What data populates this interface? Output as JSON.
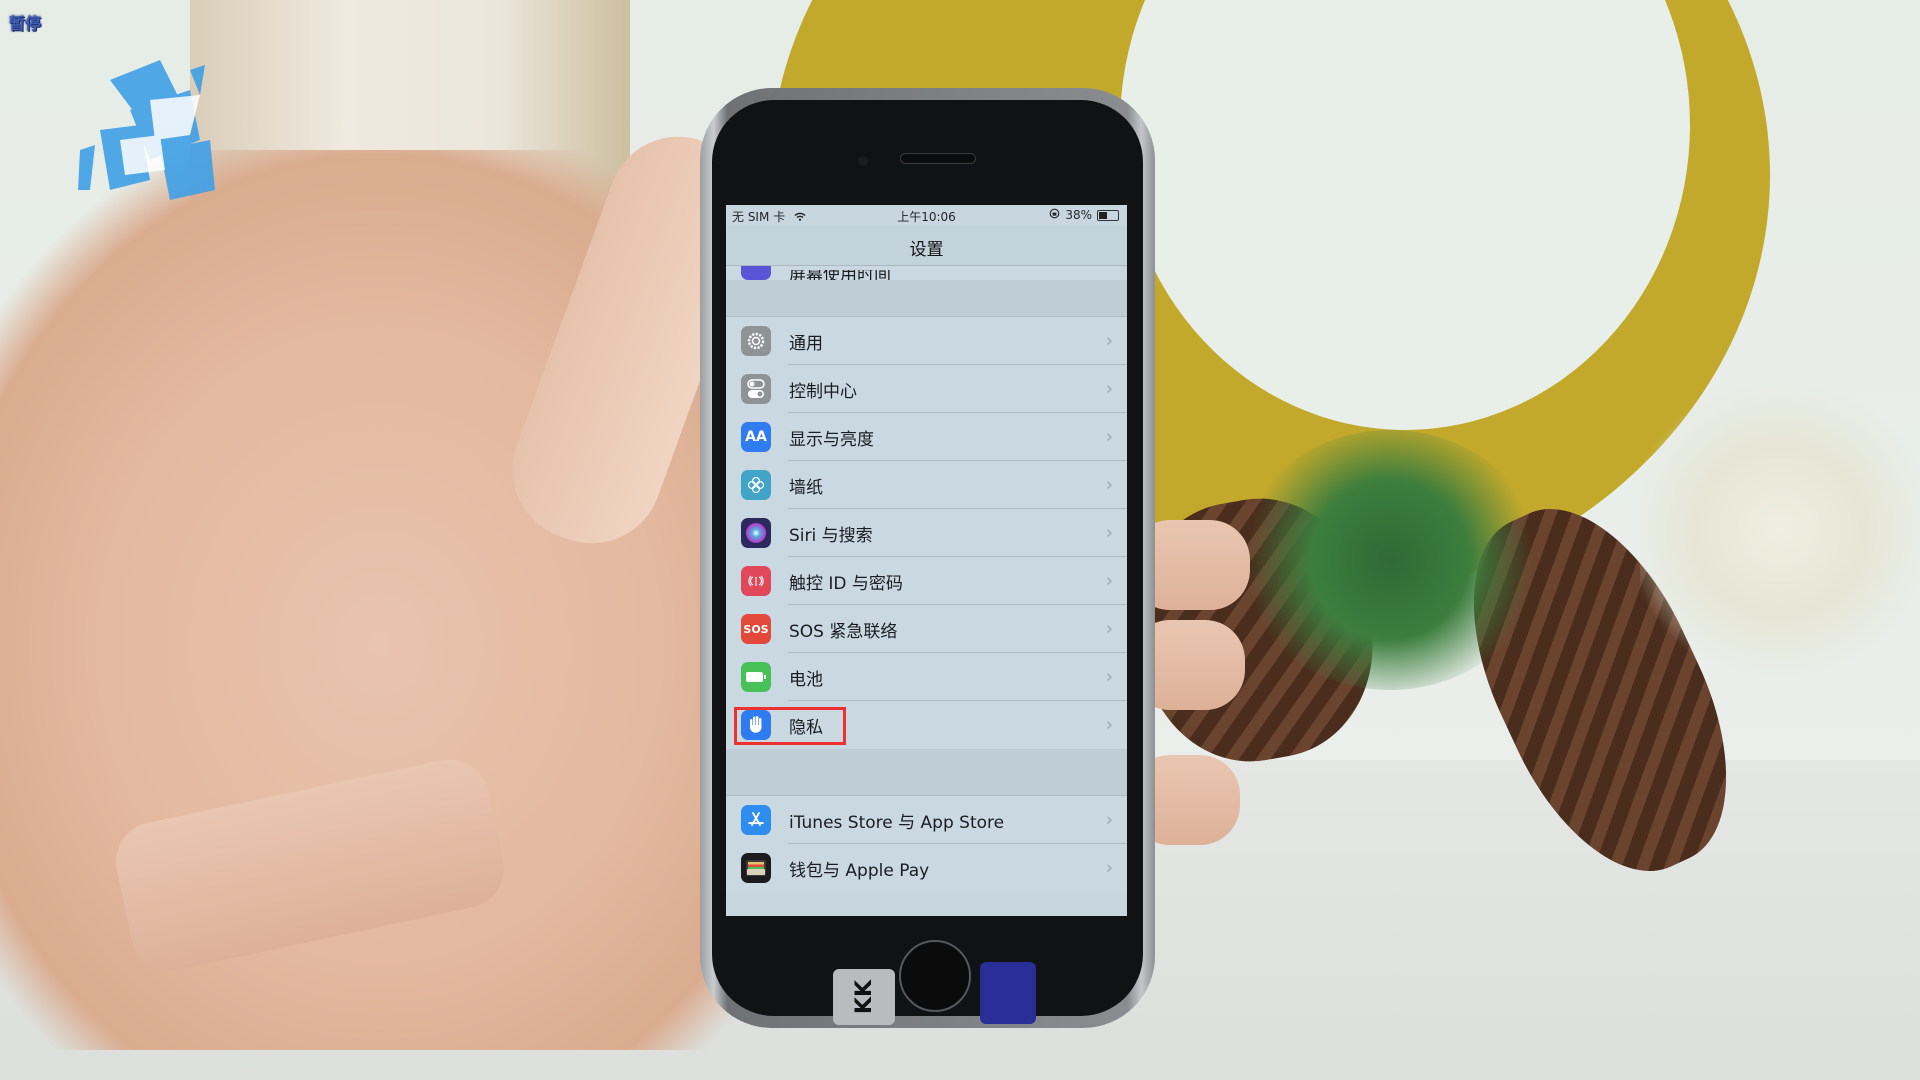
{
  "overlay": {
    "pause_label": "暂停"
  },
  "status_bar": {
    "carrier": "无 SIM 卡",
    "wifi_icon": "wifi-icon",
    "time": "上午10:06",
    "rotation_lock_icon": "rotation-lock-icon",
    "battery_percent": "38%",
    "battery_level": 0.38
  },
  "nav": {
    "title": "设置"
  },
  "settings": {
    "clipped_item": {
      "label": "屏幕使用时间",
      "icon": "hourglass-icon",
      "color": "#5a55d6"
    },
    "group1": [
      {
        "label": "通用",
        "icon": "gear-icon",
        "color": "#8e9396"
      },
      {
        "label": "控制中心",
        "icon": "toggle-switches-icon",
        "color": "#8e9396"
      },
      {
        "label": "显示与亮度",
        "icon": "text-size-aa-icon",
        "color": "#2f7cf0",
        "glyph": "AA"
      },
      {
        "label": "墙纸",
        "icon": "flower-icon",
        "color": "#3fa4c8"
      },
      {
        "label": "Siri 与搜索",
        "icon": "siri-icon",
        "color": "#2b2a5c"
      },
      {
        "label": "触控 ID 与密码",
        "icon": "fingerprint-icon",
        "color": "#e0485a"
      },
      {
        "label": "SOS 紧急联络",
        "icon": "sos-icon",
        "color": "#e2493a",
        "glyph": "SOS"
      },
      {
        "label": "电池",
        "icon": "battery-icon",
        "color": "#48c257"
      },
      {
        "label": "隐私",
        "icon": "hand-icon",
        "color": "#2f7cf0",
        "highlighted": true
      }
    ],
    "group2": [
      {
        "label": "iTunes Store 与 App Store",
        "icon": "app-store-icon",
        "color": "#2d8ef0"
      },
      {
        "label": "钱包与 Apple Pay",
        "icon": "wallet-icon",
        "color": "#1c1c1e"
      }
    ],
    "chevron": "›"
  },
  "phone_stickers": {
    "left": "KK",
    "right": ""
  },
  "colors": {
    "highlight_box": "#ef3030",
    "screen_bg": "#c9d8e1"
  }
}
